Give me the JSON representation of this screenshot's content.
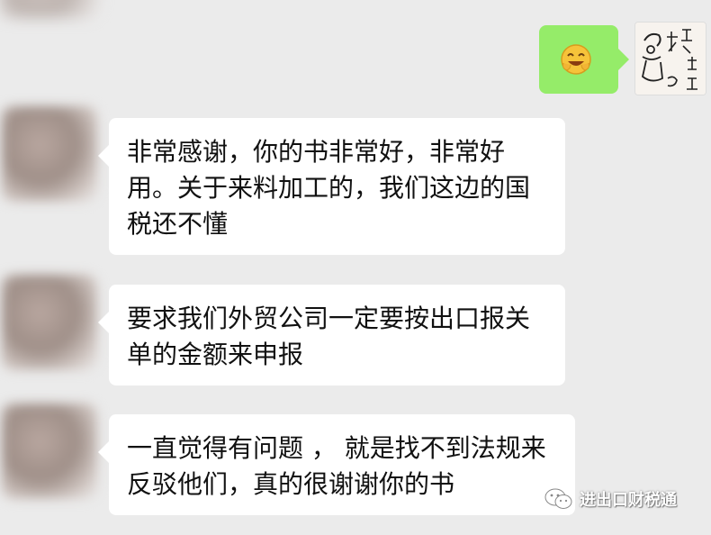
{
  "messages": [
    {
      "text": "非常感谢，你的书非常好，非常好用。关于来料加工的，我们这边的国税还不懂"
    },
    {
      "text": "要求我们外贸公司一定要按出口报关单的金额来申报"
    },
    {
      "text": "一直觉得有问题 ， 就是找不到法规来反驳他们，真的很谢谢你的书"
    }
  ],
  "sent": {
    "emoji": "laughing-emoji",
    "bubble_color": "#95ec69"
  },
  "watermark": {
    "text": "进出口财税通",
    "icon": "wechat-icon"
  },
  "colors": {
    "background": "#ebebeb",
    "bubble": "#ffffff"
  }
}
